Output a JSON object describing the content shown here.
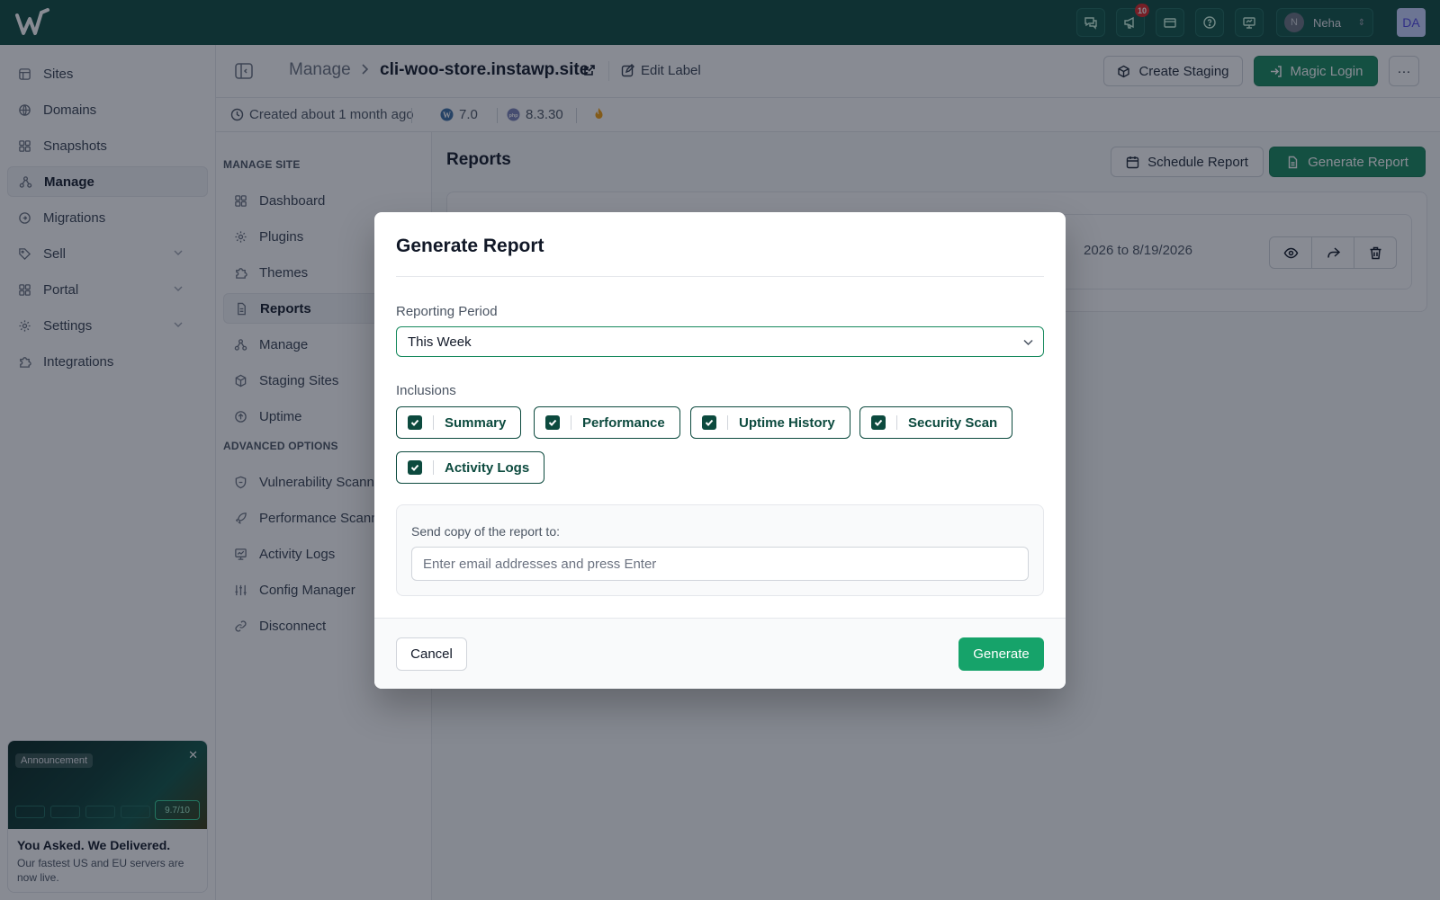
{
  "app": {
    "brand": "InstaWP",
    "accent_color": "#0c4a3e",
    "button_green": "#16895d"
  },
  "topbar": {
    "icons": [
      "chat-icon",
      "megaphone-icon",
      "ticket-icon",
      "help-icon",
      "presentation-icon"
    ],
    "notification_count": "10",
    "user_initial": "N",
    "user_name": "Neha",
    "avatar_text": "DA"
  },
  "sidebar": {
    "items": [
      {
        "label": "Sites",
        "icon": "sites-icon"
      },
      {
        "label": "Domains",
        "icon": "globe-icon"
      },
      {
        "label": "Snapshots",
        "icon": "grid-icon"
      },
      {
        "label": "Manage",
        "icon": "manage-icon",
        "active": true
      },
      {
        "label": "Migrations",
        "icon": "migrate-icon"
      },
      {
        "label": "Sell",
        "icon": "tag-icon",
        "expandable": true
      },
      {
        "label": "Portal",
        "icon": "grid-icon",
        "expandable": true
      },
      {
        "label": "Settings",
        "icon": "gear-icon",
        "expandable": true
      },
      {
        "label": "Integrations",
        "icon": "puzzle-icon"
      }
    ],
    "promo": {
      "tag": "Announcement",
      "score": "9.7/10",
      "title": "You Asked. We Delivered.",
      "text": "Our fastest US and EU servers are now live."
    }
  },
  "header": {
    "breadcrumb_root": "Manage",
    "site_name": "cli-woo-store.instawp.site",
    "edit_label": "Edit Label",
    "create_staging": "Create Staging",
    "magic_login": "Magic Login",
    "more": "···"
  },
  "meta": {
    "created": "Created about 1 month ago",
    "wp_version": "7.0",
    "php_version": "8.3.30"
  },
  "subnav": {
    "manage_title": "MANAGE SITE",
    "manage_items": [
      "Dashboard",
      "Plugins",
      "Themes",
      "Reports",
      "Manage",
      "Staging Sites",
      "Uptime"
    ],
    "advanced_title": "ADVANCED OPTIONS",
    "advanced_items": [
      "Vulnerability Scanner",
      "Performance Scanner",
      "Activity Logs",
      "Config Manager",
      "Disconnect"
    ]
  },
  "main": {
    "title": "Reports",
    "schedule_report": "Schedule Report",
    "generate_report": "Generate Report",
    "report_period_text": "2026 to 8/19/2026"
  },
  "modal": {
    "title": "Generate Report",
    "period_label": "Reporting Period",
    "period_value": "This Week",
    "inclusions_label": "Inclusions",
    "inclusions": [
      "Summary",
      "Performance",
      "Uptime History",
      "Security Scan",
      "Activity Logs"
    ],
    "email_label": "Send copy of the report to:",
    "email_placeholder": "Enter email addresses and press Enter",
    "email_value": "",
    "cancel": "Cancel",
    "generate": "Generate"
  }
}
